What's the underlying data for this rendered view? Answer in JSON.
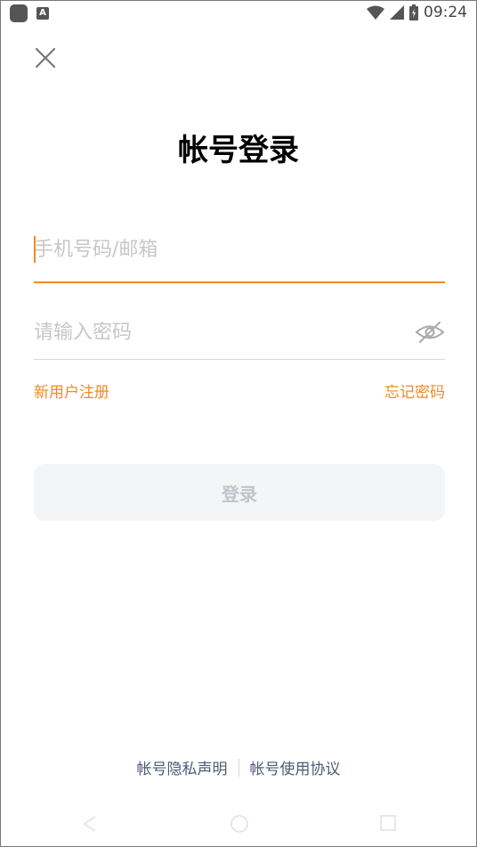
{
  "status_bar": {
    "time": "09:24",
    "a_badge": "A"
  },
  "header": {
    "title": "帐号登录"
  },
  "form": {
    "phone_placeholder": "手机号码/邮箱",
    "phone_value": "",
    "password_placeholder": "请输入密码",
    "password_value": ""
  },
  "links": {
    "register": "新用户注册",
    "forgot": "忘记密码"
  },
  "login_button": {
    "label": "登录"
  },
  "footer": {
    "privacy": "帐号隐私声明",
    "agreement": "帐号使用协议"
  },
  "colors": {
    "accent": "#f08a24",
    "button_bg": "#f4f5f7",
    "footer_text": "#4d5a78"
  }
}
